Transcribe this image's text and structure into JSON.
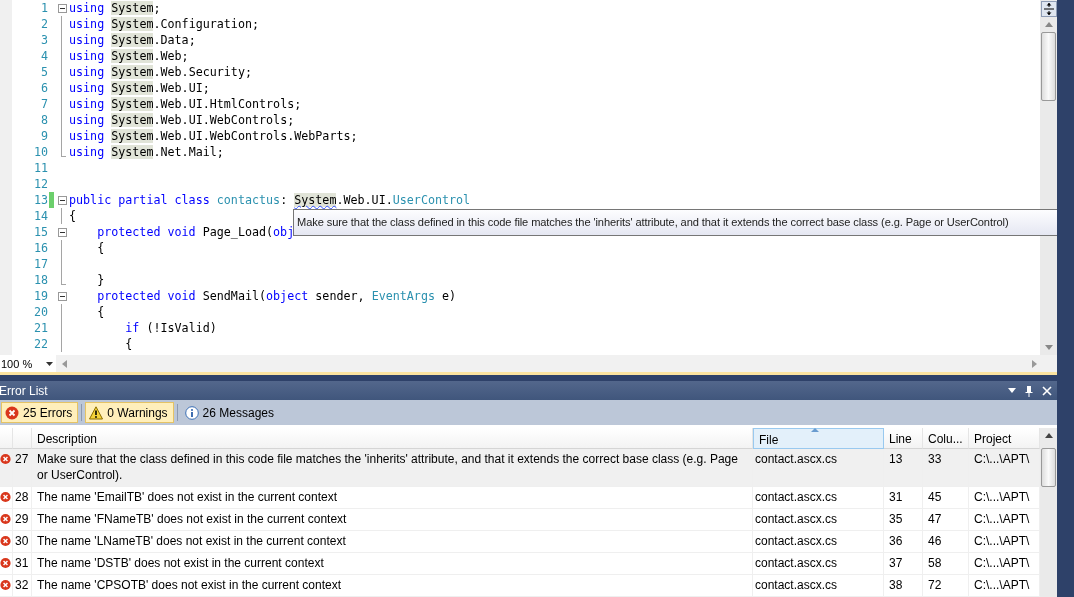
{
  "editor": {
    "lines": [
      {
        "number": "1",
        "kind": "fold-start",
        "changed": false,
        "tokens": [
          {
            "kind": "keyword",
            "text": "using "
          },
          {
            "kind": "ref",
            "text": "System"
          },
          {
            "kind": "plain",
            "text": ";"
          }
        ]
      },
      {
        "number": "2",
        "kind": "fold-inside",
        "changed": false,
        "tokens": [
          {
            "kind": "keyword",
            "text": "using "
          },
          {
            "kind": "ref",
            "text": "System"
          },
          {
            "kind": "plain",
            "text": ".Configuration;"
          }
        ]
      },
      {
        "number": "3",
        "kind": "fold-inside",
        "changed": false,
        "tokens": [
          {
            "kind": "keyword",
            "text": "using "
          },
          {
            "kind": "ref",
            "text": "System"
          },
          {
            "kind": "plain",
            "text": ".Data;"
          }
        ]
      },
      {
        "number": "4",
        "kind": "fold-inside",
        "changed": false,
        "tokens": [
          {
            "kind": "keyword",
            "text": "using "
          },
          {
            "kind": "ref",
            "text": "System"
          },
          {
            "kind": "plain",
            "text": ".Web;"
          }
        ]
      },
      {
        "number": "5",
        "kind": "fold-inside",
        "changed": false,
        "tokens": [
          {
            "kind": "keyword",
            "text": "using "
          },
          {
            "kind": "ref",
            "text": "System"
          },
          {
            "kind": "plain",
            "text": ".Web.Security;"
          }
        ]
      },
      {
        "number": "6",
        "kind": "fold-inside",
        "changed": false,
        "tokens": [
          {
            "kind": "keyword",
            "text": "using "
          },
          {
            "kind": "ref",
            "text": "System"
          },
          {
            "kind": "plain",
            "text": ".Web.UI;"
          }
        ]
      },
      {
        "number": "7",
        "kind": "fold-inside",
        "changed": false,
        "tokens": [
          {
            "kind": "keyword",
            "text": "using "
          },
          {
            "kind": "ref",
            "text": "System"
          },
          {
            "kind": "plain",
            "text": ".Web.UI.HtmlControls;"
          }
        ]
      },
      {
        "number": "8",
        "kind": "fold-inside",
        "changed": false,
        "tokens": [
          {
            "kind": "keyword",
            "text": "using "
          },
          {
            "kind": "ref",
            "text": "System"
          },
          {
            "kind": "plain",
            "text": ".Web.UI.WebControls;"
          }
        ]
      },
      {
        "number": "9",
        "kind": "fold-inside",
        "changed": false,
        "tokens": [
          {
            "kind": "keyword",
            "text": "using "
          },
          {
            "kind": "ref",
            "text": "System"
          },
          {
            "kind": "plain",
            "text": ".Web.UI.WebControls.WebParts;"
          }
        ]
      },
      {
        "number": "10",
        "kind": "fold-end",
        "changed": false,
        "tokens": [
          {
            "kind": "keyword",
            "text": "using "
          },
          {
            "kind": "ref",
            "text": "System"
          },
          {
            "kind": "plain",
            "text": ".Net.Mail;"
          }
        ]
      },
      {
        "number": "11",
        "kind": "plain",
        "changed": false
      },
      {
        "number": "12",
        "kind": "plain",
        "changed": false
      },
      {
        "number": "13",
        "kind": "fold-start",
        "changed": true,
        "tokens": [
          {
            "kind": "keyword",
            "text": "public partial class "
          },
          {
            "kind": "type",
            "text": "contactus"
          },
          {
            "kind": "plain",
            "text": ": "
          },
          {
            "kind": "error-ref",
            "text": "System"
          },
          {
            "kind": "plain",
            "text": ".Web.UI."
          },
          {
            "kind": "type",
            "text": "UserControl"
          }
        ]
      },
      {
        "number": "14",
        "kind": "fold-inside",
        "changed": false,
        "tokens": [
          {
            "kind": "plain",
            "text": "{"
          }
        ]
      },
      {
        "number": "15",
        "kind": "fold-start",
        "changed": false,
        "tokens": [
          {
            "kind": "keyword",
            "text": "    protected void"
          },
          {
            "kind": "plain",
            "text": " Page_Load("
          },
          {
            "kind": "keyword",
            "text": "obj"
          }
        ]
      },
      {
        "number": "16",
        "kind": "fold-inside",
        "changed": false,
        "tokens": [
          {
            "kind": "plain",
            "text": "    {"
          }
        ]
      },
      {
        "number": "17",
        "kind": "fold-inside",
        "changed": false
      },
      {
        "number": "18",
        "kind": "fold-end",
        "changed": false,
        "tokens": [
          {
            "kind": "plain",
            "text": "    }"
          }
        ]
      },
      {
        "number": "19",
        "kind": "fold-start",
        "changed": false,
        "tokens": [
          {
            "kind": "keyword",
            "text": "    protected void"
          },
          {
            "kind": "plain",
            "text": " SendMail("
          },
          {
            "kind": "keyword",
            "text": "object"
          },
          {
            "kind": "plain",
            "text": " sender, "
          },
          {
            "kind": "type",
            "text": "EventArgs"
          },
          {
            "kind": "plain",
            "text": " e)"
          }
        ]
      },
      {
        "number": "20",
        "kind": "fold-inside",
        "changed": false,
        "tokens": [
          {
            "kind": "plain",
            "text": "    {"
          }
        ]
      },
      {
        "number": "21",
        "kind": "fold-inside",
        "changed": false,
        "tokens": [
          {
            "kind": "keyword",
            "text": "        if"
          },
          {
            "kind": "plain",
            "text": " (!IsValid)"
          }
        ]
      },
      {
        "number": "22",
        "kind": "fold-inside",
        "changed": false,
        "tokens": [
          {
            "kind": "plain",
            "text": "        {"
          }
        ]
      }
    ],
    "tooltip": "Make sure that the class defined in this code file matches the 'inherits' attribute, and that it extends the correct base class (e.g. Page or UserControl)",
    "zoom": "100 %"
  },
  "error_list": {
    "title": "Error List",
    "filters": [
      {
        "kind": "error",
        "label": "25 Errors",
        "selected": true
      },
      {
        "kind": "warning",
        "label": "0 Warnings",
        "selected": true
      },
      {
        "kind": "info",
        "label": "26 Messages",
        "selected": false
      }
    ],
    "columns": [
      {
        "label": "Description",
        "sorted": false
      },
      {
        "label": "File",
        "sorted": true
      },
      {
        "label": "Line",
        "sorted": false
      },
      {
        "label": "Colu...",
        "sorted": false
      },
      {
        "label": "Project",
        "sorted": false
      }
    ],
    "rows": [
      {
        "number": "27",
        "description": "Make sure that the class defined in this code file matches the 'inherits' attribute, and that it extends the correct base class (e.g. Page or UserControl).",
        "file": "contact.ascx.cs",
        "line": "13",
        "column": "33",
        "project": "C:\\...\\APT\\",
        "selected": true
      },
      {
        "number": "28",
        "description": "The name 'EmailTB' does not exist in the current context",
        "file": "contact.ascx.cs",
        "line": "31",
        "column": "45",
        "project": "C:\\...\\APT\\",
        "selected": false
      },
      {
        "number": "29",
        "description": "The name 'FNameTB' does not exist in the current context",
        "file": "contact.ascx.cs",
        "line": "35",
        "column": "47",
        "project": "C:\\...\\APT\\",
        "selected": false
      },
      {
        "number": "30",
        "description": "The name 'LNameTB' does not exist in the current context",
        "file": "contact.ascx.cs",
        "line": "36",
        "column": "46",
        "project": "C:\\...\\APT\\",
        "selected": false
      },
      {
        "number": "31",
        "description": "The name 'DSTB' does not exist in the current context",
        "file": "contact.ascx.cs",
        "line": "37",
        "column": "58",
        "project": "C:\\...\\APT\\",
        "selected": false
      },
      {
        "number": "32",
        "description": "The name 'CPSOTB' does not exist in the current context",
        "file": "contact.ascx.cs",
        "line": "38",
        "column": "72",
        "project": "C:\\...\\APT\\",
        "selected": false
      }
    ]
  }
}
